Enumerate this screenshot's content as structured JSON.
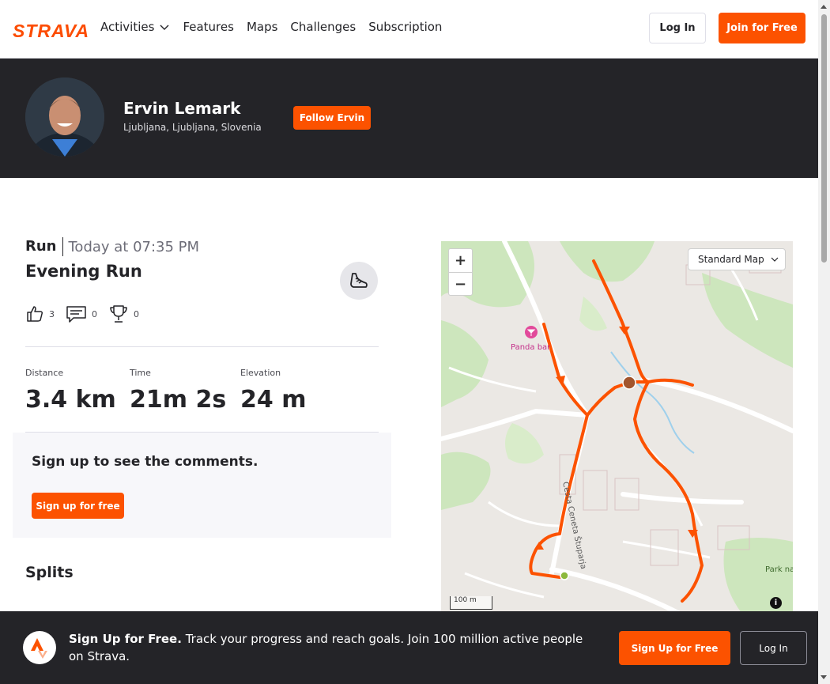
{
  "nav": {
    "logo": "STRAVA",
    "menu": [
      "Activities",
      "Features",
      "Maps",
      "Challenges",
      "Subscription"
    ],
    "login": "Log In",
    "join": "Join for Free"
  },
  "athlete": {
    "name": "Ervin Lemark",
    "location": "Ljubljana, Ljubljana, Slovenia",
    "follow": "Follow Ervin"
  },
  "activity": {
    "type": "Run",
    "date": "Today at 07:35 PM",
    "title": "Evening Run",
    "kudos": "3",
    "comments": "0",
    "achievements": "0",
    "stats": [
      {
        "label": "Distance",
        "value": "3.4 km"
      },
      {
        "label": "Time",
        "value": "21m 2s"
      },
      {
        "label": "Elevation",
        "value": "24 m"
      }
    ]
  },
  "comments_box": {
    "title": "Sign up to see the comments.",
    "button": "Sign up for free"
  },
  "splits": {
    "title": "Splits"
  },
  "map": {
    "zoom_in": "+",
    "zoom_out": "−",
    "style": "Standard Map",
    "scale": "100 m",
    "info": "i",
    "labels": {
      "poi": "Panda bar",
      "street": "Cesta Ceneta Štuparja",
      "park": "Park na"
    }
  },
  "banner": {
    "headline": "Sign Up for Free.",
    "text": "Track your progress and reach goals. Join 100 million active people on Strava.",
    "signup": "Sign Up for Free",
    "login": "Log In"
  },
  "colors": {
    "brand": "#fc5200",
    "dark": "#242428",
    "route": "#fc5200"
  }
}
